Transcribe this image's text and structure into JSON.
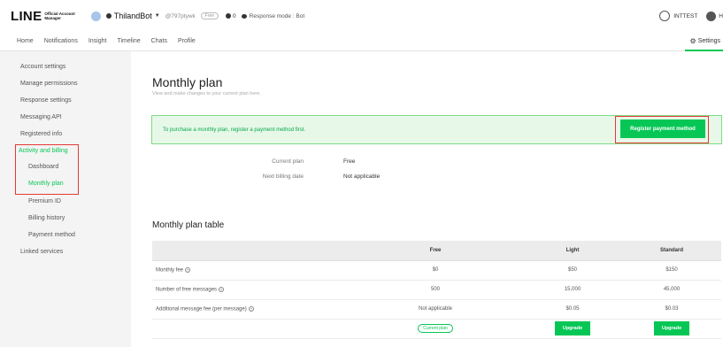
{
  "header": {
    "logo_main": "LINE",
    "logo_sub_lines": [
      "Official Account",
      "Manager"
    ],
    "account_name": "ThilandBot",
    "account_id": "@797ptywk",
    "plan_badge": "Free",
    "friend_count": "0",
    "response_mode": "Response mode : Bot",
    "user_name": "INTTEST",
    "help_label": "H"
  },
  "nav": {
    "items": [
      "Home",
      "Notifications",
      "Insight",
      "Timeline",
      "Chats",
      "Profile"
    ],
    "settings_label": "Settings"
  },
  "sidebar": {
    "items": [
      {
        "label": "Account settings"
      },
      {
        "label": "Manage permissions"
      },
      {
        "label": "Response settings"
      },
      {
        "label": "Messaging API"
      },
      {
        "label": "Registered info"
      },
      {
        "label": "Activity and billing"
      },
      {
        "label": "Dashboard"
      },
      {
        "label": "Monthly plan"
      },
      {
        "label": "Premium ID"
      },
      {
        "label": "Billing history"
      },
      {
        "label": "Payment method"
      },
      {
        "label": "Linked services"
      }
    ]
  },
  "main": {
    "title": "Monthly plan",
    "subtitle": "View and make changes to your current plan here.",
    "notice_text": "To purchase a monthly plan, register a payment method first.",
    "register_button": "Register payment method",
    "current_plan_label": "Current plan",
    "current_plan_value": "Free",
    "next_billing_label": "Next billing date",
    "next_billing_value": "Not applicable",
    "table_title": "Monthly plan table",
    "table": {
      "columns": [
        "",
        "Free",
        "Light",
        "Standard"
      ],
      "rows": [
        {
          "label": "Monthly fee",
          "values": [
            "$0",
            "$50",
            "$150"
          ]
        },
        {
          "label": "Number of free messages",
          "values": [
            "500",
            "15,000",
            "45,000"
          ]
        },
        {
          "label": "Additional message fee (per message)",
          "values": [
            "Not applicable",
            "$0.05",
            "$0.03"
          ]
        }
      ],
      "current_plan_badge": "Current plan",
      "upgrade_label": "Upgrade"
    }
  },
  "colors": {
    "accent": "#06c755",
    "highlight_outline": "#e53935",
    "notice_bg": "#e7f8e8"
  },
  "icons": {
    "avatar": "account-avatar-icon",
    "user": "user-icon",
    "help": "help-icon",
    "settings": "gear-icon"
  }
}
